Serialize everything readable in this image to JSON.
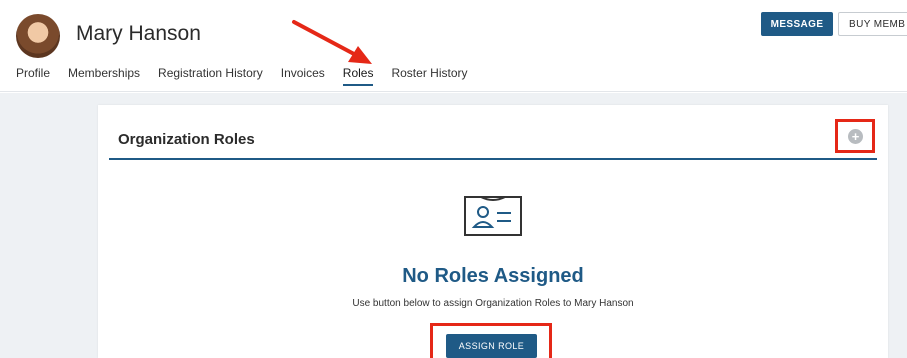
{
  "profile": {
    "name": "Mary Hanson"
  },
  "actions": {
    "message_label": "MESSAGE",
    "buy_label": "BUY MEMB"
  },
  "tabs": [
    {
      "label": "Profile"
    },
    {
      "label": "Memberships"
    },
    {
      "label": "Registration History"
    },
    {
      "label": "Invoices"
    },
    {
      "label": "Roles",
      "active": true
    },
    {
      "label": "Roster History"
    }
  ],
  "card": {
    "title": "Organization Roles",
    "empty_title": "No Roles Assigned",
    "empty_desc": "Use button below to assign Organization Roles to Mary Hanson",
    "assign_label": "ASSIGN ROLE"
  },
  "icons": {
    "add": "plus-circle-icon",
    "empty_state": "id-badge-icon",
    "arrow": "red-arrow-icon"
  },
  "colors": {
    "accent": "#1f5a86",
    "annotation_red": "#e52817",
    "page_bg": "#eef1f4"
  }
}
